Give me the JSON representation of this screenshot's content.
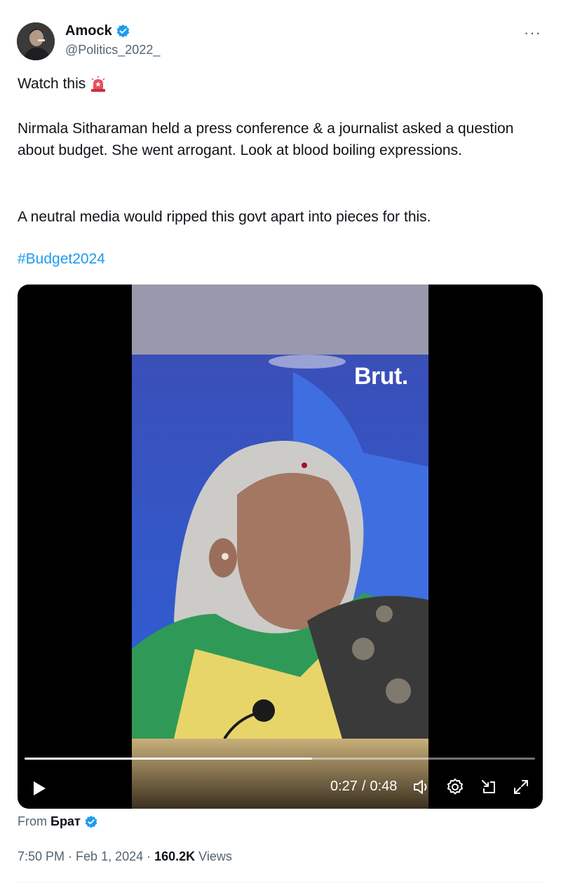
{
  "author": {
    "name": "Amock",
    "handle": "@Politics_2022_"
  },
  "tweet": {
    "line1": "Watch this",
    "line1_emoji": "rotating-light-icon",
    "para1": "Nirmala Sitharaman held a press conference & a journalist asked a question about budget. She went arrogant. Look at blood boiling expressions.",
    "para2": "A neutral media would ripped this govt apart into pieces for this.",
    "hashtag": "#Budget2024"
  },
  "video": {
    "watermark": "Brut.",
    "current_time": "0:27",
    "separator": "/",
    "duration": "0:48",
    "progress_fraction": 0.5625
  },
  "attribution": {
    "prefix": "From",
    "source": "Брат"
  },
  "meta": {
    "time": "7:50 PM",
    "dot1": "·",
    "date": "Feb 1, 2024",
    "dot2": "·",
    "views_count": "160.2K",
    "views_label": "Views"
  },
  "more_menu": "···",
  "colors": {
    "accent": "#1d9bf0",
    "text": "#0f1419",
    "secondary": "#536471"
  }
}
